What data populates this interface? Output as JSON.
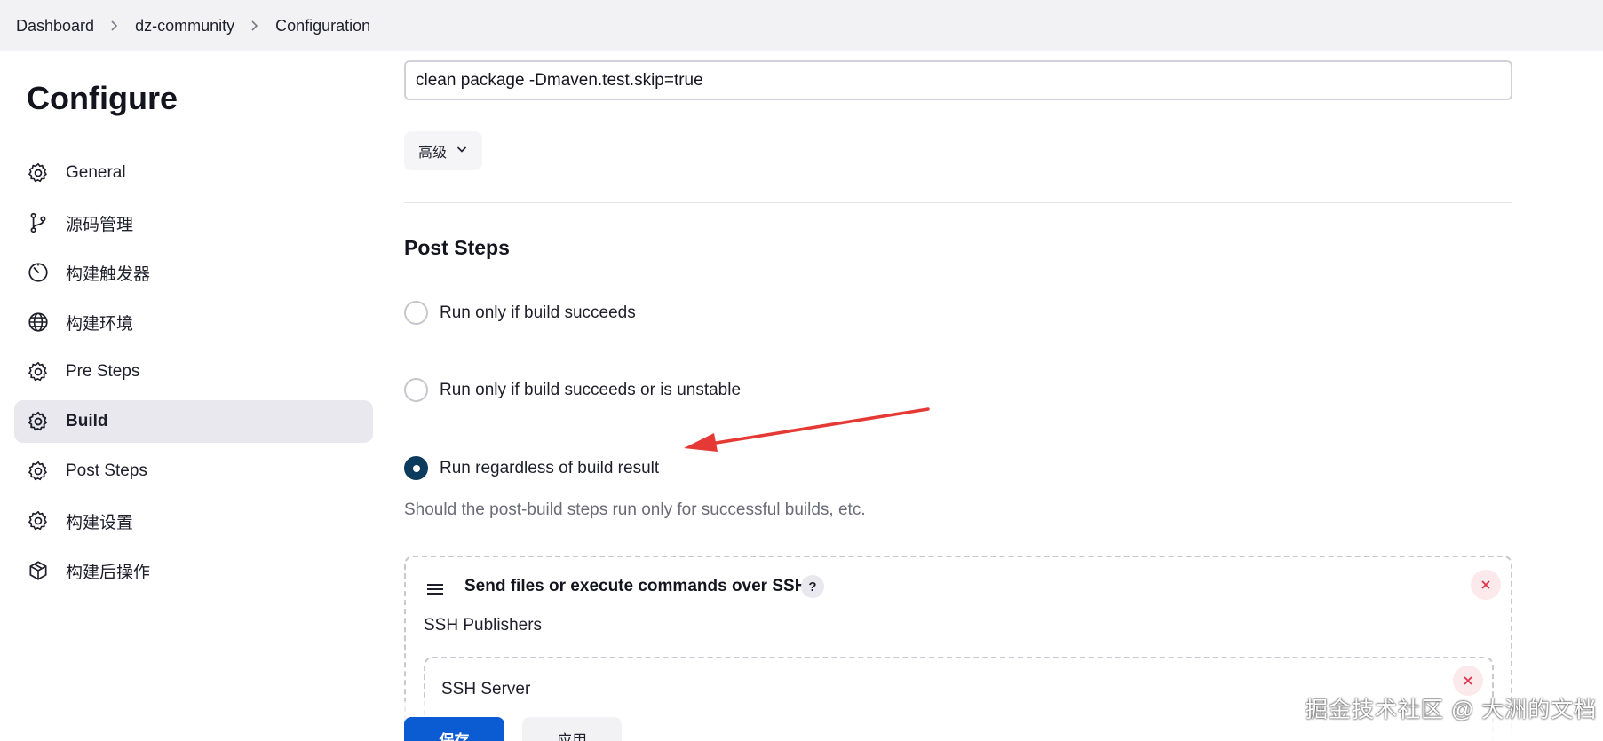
{
  "breadcrumb": [
    "Dashboard",
    "dz-community",
    "Configuration"
  ],
  "page": {
    "title": "Configure"
  },
  "sidebar": {
    "items": [
      {
        "label": "General",
        "icon": "gear-icon",
        "active": false
      },
      {
        "label": "源码管理",
        "icon": "branch-icon",
        "active": false
      },
      {
        "label": "构建触发器",
        "icon": "timer-icon",
        "active": false
      },
      {
        "label": "构建环境",
        "icon": "globe-icon",
        "active": false
      },
      {
        "label": "Pre Steps",
        "icon": "gear-icon",
        "active": false
      },
      {
        "label": "Build",
        "icon": "gear-icon",
        "active": true
      },
      {
        "label": "Post Steps",
        "icon": "gear-icon",
        "active": false
      },
      {
        "label": "构建设置",
        "icon": "gear-icon",
        "active": false
      },
      {
        "label": "构建后操作",
        "icon": "package-icon",
        "active": false
      }
    ]
  },
  "build": {
    "goals_value": "clean package -Dmaven.test.skip=true",
    "advanced_label": "高级"
  },
  "post_steps": {
    "title": "Post Steps",
    "options": [
      {
        "label": "Run only if build succeeds",
        "checked": false
      },
      {
        "label": "Run only if build succeeds or is unstable",
        "checked": false
      },
      {
        "label": "Run regardless of build result",
        "checked": true
      }
    ],
    "help": "Should the post-build steps run only for successful builds, etc."
  },
  "ssh": {
    "title": "Send files or execute commands over SSH",
    "help_badge": "?",
    "publishers_label": "SSH Publishers",
    "server_label": "SSH Server"
  },
  "footer": {
    "save_label": "保存",
    "apply_label": "应用"
  },
  "watermark": "掘金技术社区 @ 大洲的文档",
  "colors": {
    "accent": "#0b5bd3",
    "radio_checked": "#0d3b5e",
    "annotation_arrow": "#e53935",
    "danger": "#e0344b"
  }
}
